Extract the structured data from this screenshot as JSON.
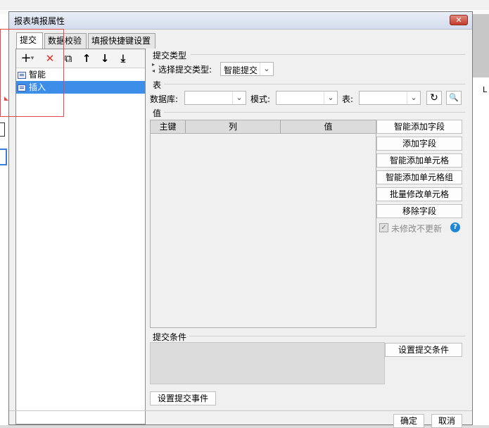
{
  "dialog": {
    "title": "报表填报属性",
    "close_label": "✕"
  },
  "tabs": [
    {
      "label": "提交"
    },
    {
      "label": "数据校验"
    },
    {
      "label": "填报快捷键设置"
    }
  ],
  "left_toolbar": {
    "add": "+",
    "add_dropdown": "▾",
    "delete": "✕",
    "copy": "⧉",
    "up": "↑",
    "down": "↓",
    "bottom": "⤓"
  },
  "tree": {
    "items": [
      {
        "label": "智能"
      },
      {
        "label": "插入",
        "selected": true
      }
    ]
  },
  "submit_type": {
    "group": "提交类型",
    "select_label": "选择提交类型:",
    "value": "智能提交"
  },
  "table": {
    "group": "表",
    "database_label": "数据库:",
    "database_value": "",
    "schema_label": "模式:",
    "schema_value": "",
    "table_label": "表:",
    "table_value": ""
  },
  "values": {
    "group": "值",
    "columns": [
      "主键",
      "列",
      "值"
    ]
  },
  "actions": [
    "智能添加字段",
    "添加字段",
    "智能添加单元格",
    "智能添加单元格组",
    "批量修改单元格",
    "移除字段"
  ],
  "no_update_unmodified": {
    "label": "未修改不更新",
    "checked": true,
    "disabled": true
  },
  "conditions": {
    "group": "提交条件",
    "set_button": "设置提交条件"
  },
  "events_button": "设置提交事件",
  "footer": {
    "ok": "确定",
    "cancel": "取消"
  },
  "background": {
    "right_label": "L"
  },
  "colors": {
    "selection": "#3d8ee8",
    "close": "#c5392a",
    "help": "#1f86d6",
    "highlight_rect": "#e34a4a"
  }
}
